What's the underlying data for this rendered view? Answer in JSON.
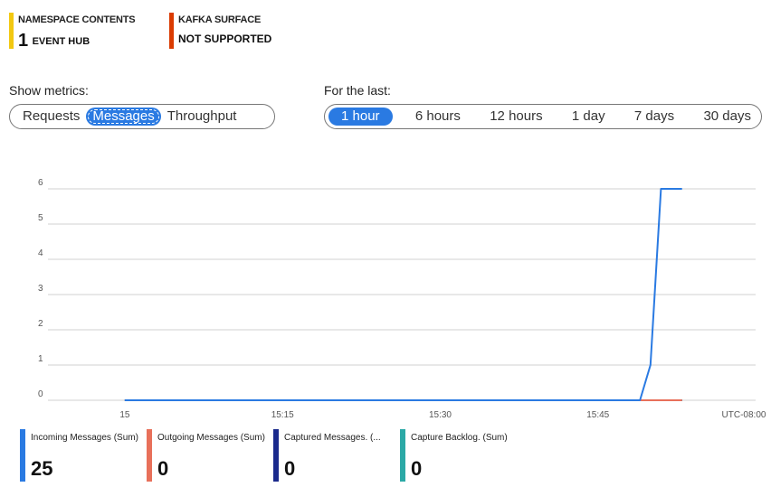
{
  "tiles": [
    {
      "label": "NAMESPACE CONTENTS",
      "value_num": "1",
      "value_text": "EVENT HUB",
      "color": "#f2c811"
    },
    {
      "label": "KAFKA SURFACE",
      "value_text": "NOT SUPPORTED",
      "color": "#da3b01"
    }
  ],
  "metrics": {
    "label": "Show metrics:",
    "options": [
      "Requests",
      "Messages",
      "Throughput"
    ],
    "selected": "Messages"
  },
  "range": {
    "label": "For the last:",
    "options": [
      "1 hour",
      "6 hours",
      "12 hours",
      "1 day",
      "7 days",
      "30 days"
    ],
    "selected": "1 hour"
  },
  "chart_data": {
    "type": "line",
    "y_ticks": [
      "0",
      "1",
      "2",
      "3",
      "4",
      "5",
      "6"
    ],
    "ylim": [
      0,
      6
    ],
    "x_ticks": [
      "15",
      "15:15",
      "15:30",
      "15:45",
      "UTC-08:00"
    ],
    "grid": true,
    "series": [
      {
        "name": "Incoming Messages (Sum)",
        "color": "#2a7ae2",
        "points": [
          [
            "15:00",
            0
          ],
          [
            "15:49",
            0
          ],
          [
            "15:50",
            1
          ],
          [
            "15:51",
            6
          ],
          [
            "15:53",
            6
          ]
        ]
      },
      {
        "name": "Outgoing Messages (Sum)",
        "color": "#e8705a",
        "points": [
          [
            "15:00",
            0
          ],
          [
            "15:53",
            0
          ]
        ]
      },
      {
        "name": "Captured Messages. (Sum)",
        "color": "#1a2a8c",
        "points": [
          [
            "15:00",
            0
          ],
          [
            "15:53",
            0
          ]
        ]
      },
      {
        "name": "Capture Backlog. (Sum)",
        "color": "#2ba9a6",
        "points": [
          [
            "15:00",
            0
          ],
          [
            "15:53",
            0
          ]
        ]
      }
    ]
  },
  "legend": [
    {
      "label": "Incoming Messages (Sum)",
      "value": "25",
      "color": "#2a7ae2"
    },
    {
      "label": "Outgoing Messages (Sum)",
      "value": "0",
      "color": "#e8705a"
    },
    {
      "label": "Captured Messages. (Sum)",
      "display": "Captured Messages. (...",
      "value": "0",
      "color": "#1a2a8c"
    },
    {
      "label": "Capture Backlog. (Sum)",
      "value": "0",
      "color": "#2ba9a6"
    }
  ]
}
